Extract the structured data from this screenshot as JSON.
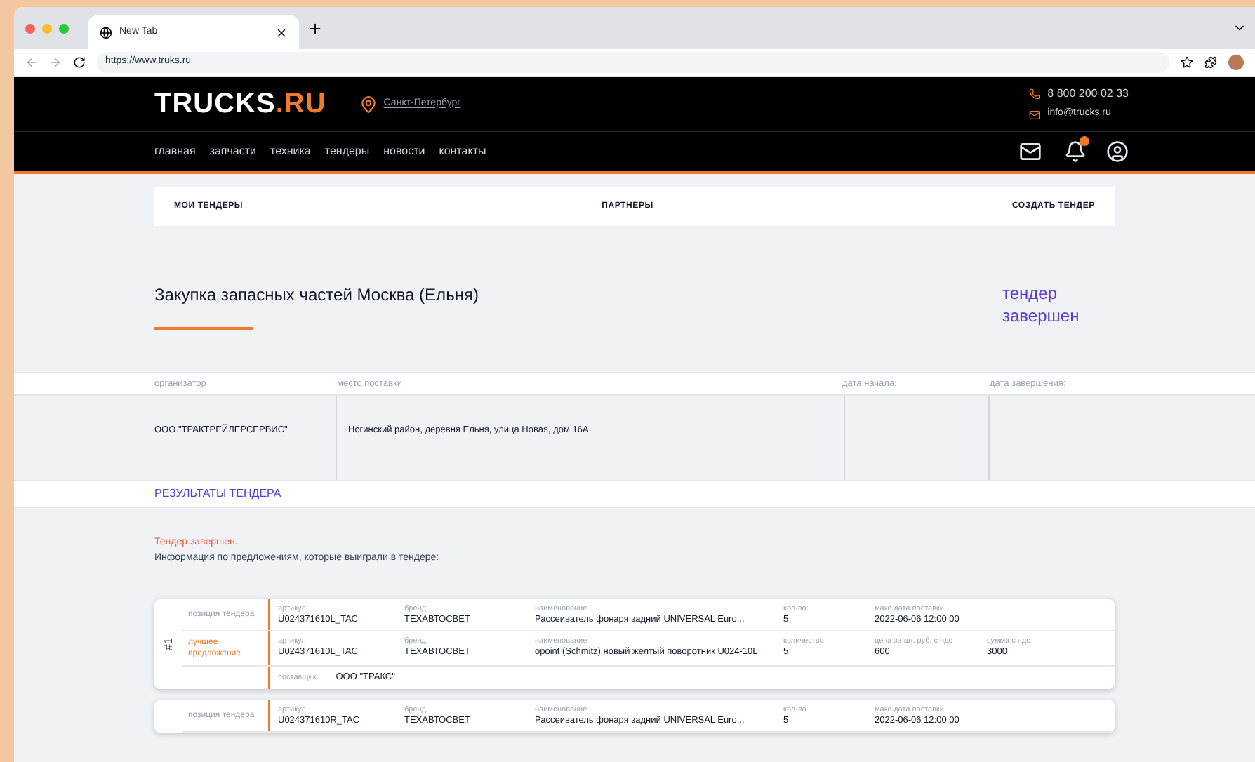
{
  "browser": {
    "tab_title": "New Tab",
    "url": "https://www.truks.ru"
  },
  "header": {
    "logo_main": "TRUCKS",
    "logo_accent": ".RU",
    "city": "Санкт-Петербург",
    "phone": "8 800 200 02 33",
    "email": "info@trucks.ru",
    "notification_badge": true,
    "nav": [
      "главная",
      "запчасти",
      "техника",
      "тендеры",
      "новости",
      "контакты"
    ]
  },
  "subnav": [
    "МОИ ТЕНДЕРЫ",
    "ПАРТНЕРЫ",
    "СОЗДАТЬ ТЕНДЕР"
  ],
  "tender": {
    "title": "Закупка запасных частей Москва (Ельня)",
    "status": "тендер завершен",
    "columns": [
      "организатор",
      "место поставки",
      "дата начала:",
      "дата завершения:"
    ],
    "row": [
      "ООО \"ТРАКТРЕЙЛЕРСЕРВИС\"",
      "Ногинский район, деревня Ельня, улица Новая, дом 16А"
    ]
  },
  "results": {
    "heading": "РЕЗУЛЬТАТЫ ТЕНДЕРА",
    "notice": "Тендер завершен.",
    "info": "Информация по предложениям, которые выиграли в тендере:",
    "lots": [
      {
        "number": "#1",
        "rows": [
          {
            "label": "позиция тендера",
            "kind": "position",
            "fields": [
              {
                "label": "артикул",
                "value": "U024371610L_TAC"
              },
              {
                "label": "бренд",
                "value": "ТЕХАВТОСВЕТ"
              },
              {
                "label": "наименование",
                "value": "Рассеиватель фонаря задний UNIVERSAL Euro..."
              },
              {
                "label": "кол-во",
                "value": "5"
              },
              {
                "label": "макс.дата поставки",
                "value": "2022-06-06 12:00:00"
              }
            ]
          },
          {
            "label": "лучшее предложение",
            "kind": "offer",
            "fields": [
              {
                "label": "артикул",
                "value": "U024371610L_TAC"
              },
              {
                "label": "бренд",
                "value": "ТЕХАВТОСВЕТ"
              },
              {
                "label": "наименование",
                "value": "opoint (Schmitz) новый желтый поворотник U024-10L"
              },
              {
                "label": "количество",
                "value": "5"
              },
              {
                "label": "цена за шт. руб. с ндс",
                "value": "600"
              },
              {
                "label": "сумма с ндс",
                "value": "3000"
              }
            ]
          }
        ],
        "supplier": {
          "label": "поставщик",
          "value": "ООО \"ТРАКС\""
        }
      },
      {
        "rows": [
          {
            "label": "позиция тендера",
            "kind": "position",
            "fields": [
              {
                "label": "артикул",
                "value": "U024371610R_TAC"
              },
              {
                "label": "бренд",
                "value": "ТЕХАВТОСВЕТ"
              },
              {
                "label": "наименование",
                "value": "Рассеиватель фонаря задний UNIVERSAL Euro..."
              },
              {
                "label": "кол-во",
                "value": "5"
              },
              {
                "label": "макс.дата поставки",
                "value": "2022-06-06 12:00:00"
              }
            ]
          }
        ]
      }
    ]
  }
}
